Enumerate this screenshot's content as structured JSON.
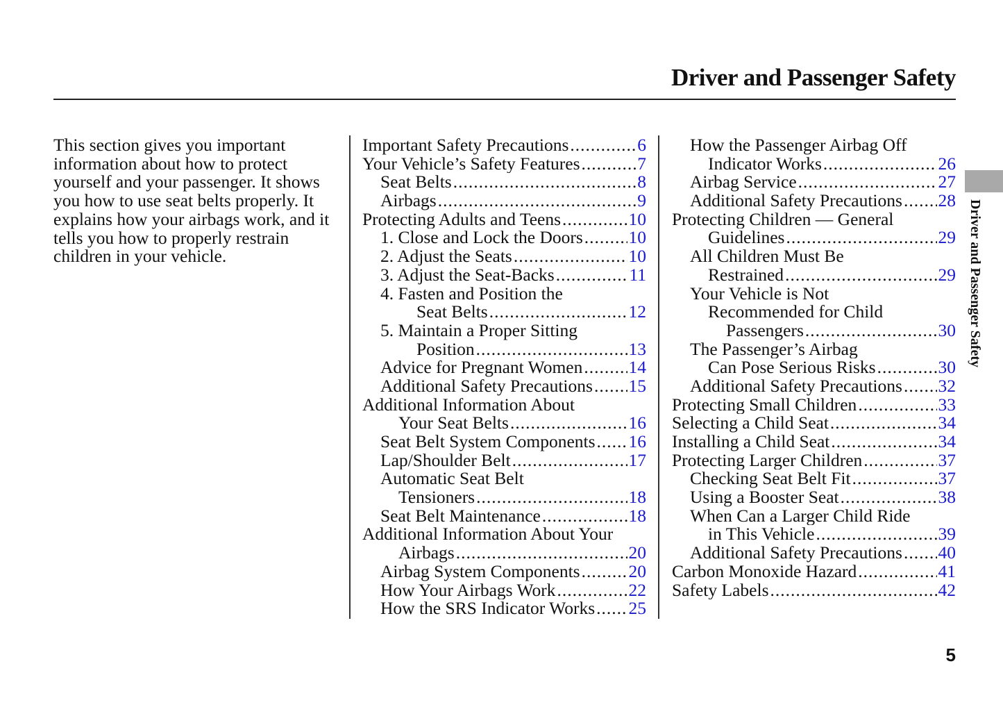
{
  "header": {
    "title": "Driver and Passenger Safety"
  },
  "side_tab": {
    "label": "Driver and Passenger Safety"
  },
  "intro": "This section gives you important information about how to protect yourself and your passenger. It shows you how to use seat belts properly. It explains how your airbags work, and it tells you how to properly restrain children in your vehicle.",
  "page_number": "5",
  "colors": {
    "page_link": "#1a1acc",
    "tab": "#a9a9a9"
  },
  "toc_columns": [
    [
      {
        "lines": [
          "Important Safety Precautions"
        ],
        "page": "6"
      },
      {
        "lines": [
          "Your Vehicle’s Safety Features"
        ],
        "page": "7"
      },
      {
        "lines": [
          "Seat Belts"
        ],
        "page": "8"
      },
      {
        "lines": [
          "Airbags"
        ],
        "page": "9"
      },
      {
        "lines": [
          "Protecting Adults and Teens"
        ],
        "page": "10"
      },
      {
        "lines": [
          "1. Close and Lock the Doors"
        ],
        "page": "10"
      },
      {
        "lines": [
          "2. Adjust the Seats"
        ],
        "page": "10"
      },
      {
        "lines": [
          "3. Adjust the Seat-Backs"
        ],
        "page": "11"
      },
      {
        "lines": [
          "4. Fasten and Position the",
          "Seat Belts"
        ],
        "page": "12"
      },
      {
        "lines": [
          "5. Maintain a Proper Sitting",
          "Position"
        ],
        "page": "13"
      },
      {
        "lines": [
          "Advice for Pregnant Women"
        ],
        "page": "14"
      },
      {
        "lines": [
          "Additional Safety Precautions"
        ],
        "page": "15"
      },
      {
        "lines": [
          "Additional Information About",
          "Your Seat Belts"
        ],
        "page": "16"
      },
      {
        "lines": [
          "Seat Belt System Components"
        ],
        "page": "16"
      },
      {
        "lines": [
          "Lap/Shoulder Belt"
        ],
        "page": "17"
      },
      {
        "lines": [
          "Automatic Seat Belt",
          "Tensioners"
        ],
        "page": "18"
      },
      {
        "lines": [
          "Seat Belt Maintenance"
        ],
        "page": "18"
      },
      {
        "lines": [
          "Additional Information About Your",
          "Airbags"
        ],
        "page": "20"
      },
      {
        "lines": [
          "Airbag System Components"
        ],
        "page": "20"
      },
      {
        "lines": [
          "How Your Airbags Work"
        ],
        "page": "22"
      },
      {
        "lines": [
          "How the SRS Indicator Works"
        ],
        "page": "25"
      }
    ],
    [
      {
        "lines": [
          "How the Passenger Airbag Off",
          "Indicator Works"
        ],
        "page": "26"
      },
      {
        "lines": [
          "Airbag Service"
        ],
        "page": "27"
      },
      {
        "lines": [
          "Additional Safety Precautions"
        ],
        "page": "28"
      },
      {
        "lines": [
          "Protecting Children — General",
          "Guidelines"
        ],
        "page": "29"
      },
      {
        "lines": [
          "All Children Must Be",
          "Restrained"
        ],
        "page": "29"
      },
      {
        "lines": [
          "Your Vehicle is Not",
          "Recommended for Child",
          "Passengers"
        ],
        "page": "30"
      },
      {
        "lines": [
          "The Passenger’s Airbag",
          "Can Pose Serious Risks"
        ],
        "page": "30"
      },
      {
        "lines": [
          "Additional Safety Precautions"
        ],
        "page": "32"
      },
      {
        "lines": [
          "Protecting Small Children"
        ],
        "page": "33"
      },
      {
        "lines": [
          "Selecting a Child Seat"
        ],
        "page": "34"
      },
      {
        "lines": [
          "Installing a Child Seat"
        ],
        "page": "34"
      },
      {
        "lines": [
          "Protecting Larger Children"
        ],
        "page": "37"
      },
      {
        "lines": [
          "Checking Seat Belt Fit"
        ],
        "page": "37"
      },
      {
        "lines": [
          "Using a Booster Seat"
        ],
        "page": "38"
      },
      {
        "lines": [
          "When Can a Larger Child Ride",
          "in This Vehicle"
        ],
        "page": "39"
      },
      {
        "lines": [
          "Additional Safety Precautions"
        ],
        "page": "40"
      },
      {
        "lines": [
          "Carbon Monoxide Hazard"
        ],
        "page": "41"
      },
      {
        "lines": [
          "Safety Labels"
        ],
        "page": "42"
      }
    ]
  ]
}
